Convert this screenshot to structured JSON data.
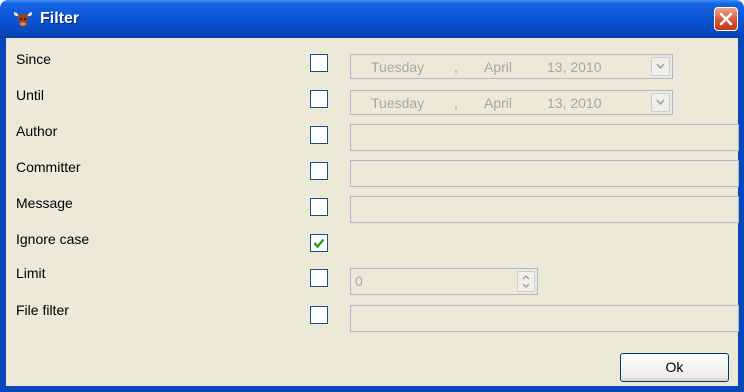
{
  "window": {
    "title": "Filter",
    "icon": "bull-icon",
    "close_icon": "close-icon"
  },
  "fields": {
    "since": {
      "label": "Since",
      "checked": false,
      "weekday": "Tuesday",
      "sep": ",",
      "month": "April",
      "date": "13, 2010"
    },
    "until": {
      "label": "Until",
      "checked": false,
      "weekday": "Tuesday",
      "sep": ",",
      "month": "April",
      "date": "13, 2010"
    },
    "author": {
      "label": "Author",
      "checked": false,
      "value": ""
    },
    "committer": {
      "label": "Committer",
      "checked": false,
      "value": ""
    },
    "message": {
      "label": "Message",
      "checked": false,
      "value": ""
    },
    "ignore_case": {
      "label": "Ignore case",
      "checked": true
    },
    "limit": {
      "label": "Limit",
      "checked": false,
      "value": "0"
    },
    "file_filter": {
      "label": "File filter",
      "checked": false,
      "value": ""
    }
  },
  "buttons": {
    "ok": "Ok"
  },
  "colors": {
    "titlebar": "#0a55d6",
    "client_bg": "#ece9d8",
    "checkbox_border": "#1c5180",
    "check_mark": "#21a121",
    "disabled_text": "#a6a6a6"
  }
}
